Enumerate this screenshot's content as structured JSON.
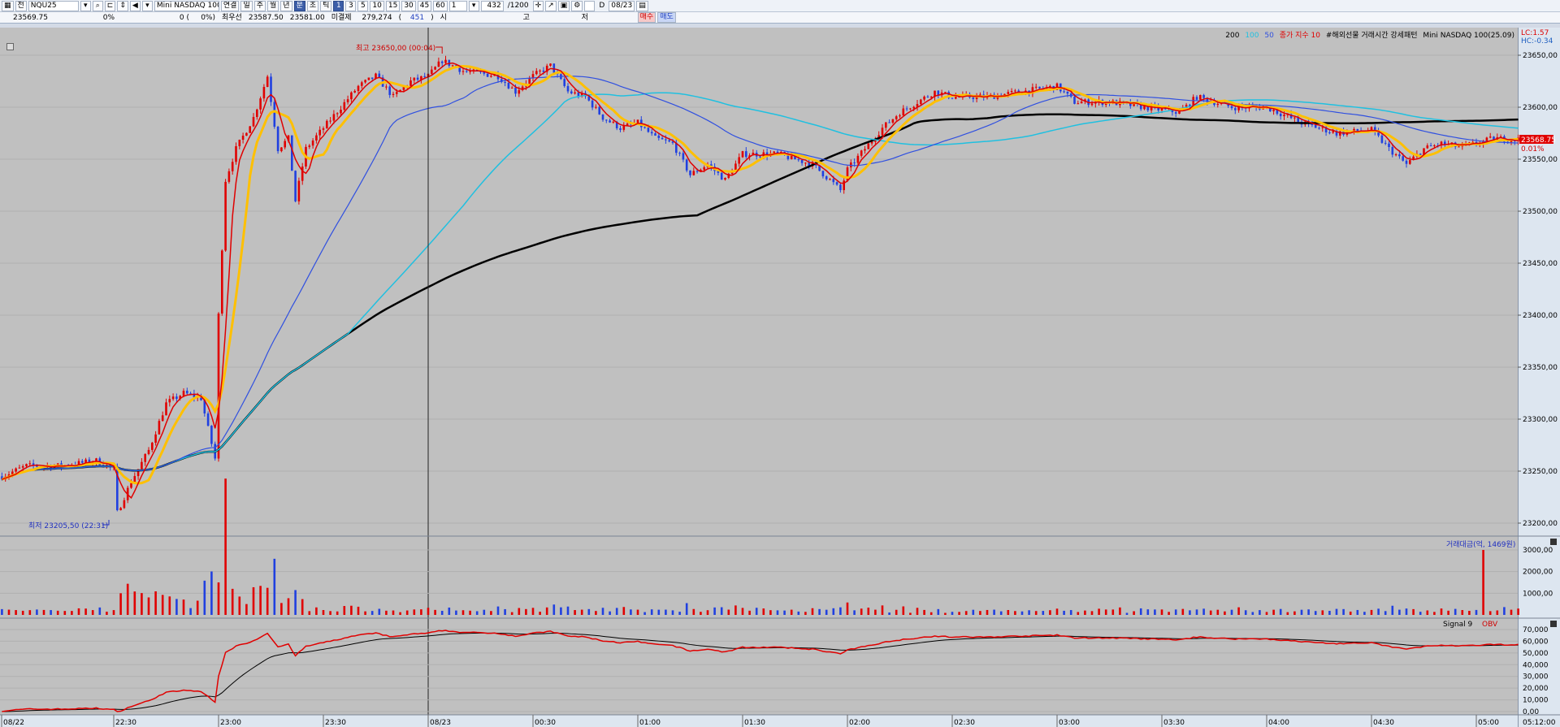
{
  "toolbar": {
    "mode_label": "전",
    "symbol": "NQU25",
    "product_name": "Mini NASDAQ 100(25.0",
    "period_tabs": [
      "연결",
      "일",
      "주",
      "월",
      "년",
      "분",
      "초",
      "틱"
    ],
    "period_selected": "분",
    "intervals": [
      "1",
      "3",
      "5",
      "10",
      "15",
      "30",
      "45",
      "60"
    ],
    "interval_selected": "1",
    "unit_value": "1",
    "count": "432",
    "count_max": "/1200",
    "d_label": "D",
    "date": "08/23"
  },
  "quote": {
    "price": "23569.75",
    "change_pct": "0%",
    "change": "0 (",
    "change_pct2": "0%)",
    "best_label": "최우선",
    "best_bid": "23587.50",
    "best_ask": "23581.00",
    "oi_label": "미결제",
    "oi": "279,274",
    "oi_open": "(",
    "oi_change": "451",
    "oi_close": ")",
    "open_label": "시",
    "high_label": "고",
    "low_label": "저",
    "buy": "매수",
    "sell": "매도"
  },
  "legend": {
    "ma200": "200",
    "ma100": "100",
    "ma50": "50",
    "close_index": "종가 지수 10",
    "pattern": "#해외선물 거래시간 강세패턴",
    "instrument": "Mini NASDAQ 100(25.09)",
    "lc": "LC:1.57",
    "hc": "HC:-0.34"
  },
  "colors": {
    "up": "#e00000",
    "down": "#2040e0",
    "ma200": "#000000",
    "ma100": "#20c0e0",
    "ma50": "#3050e0",
    "ma10": "#ffc000",
    "ma5": "#e00000"
  },
  "chart_data": {
    "type": "candlestick",
    "x_ticks": [
      "08/22",
      "22:30",
      "23:00",
      "23:30",
      "08/23",
      "00:30",
      "01:00",
      "01:30",
      "02:00",
      "02:30",
      "03:00",
      "03:30",
      "04:00",
      "04:30",
      "05:00"
    ],
    "x_end": "05:12:00",
    "price_ticks": [
      "23650,00",
      "23600,00",
      "23550,00",
      "23500,00",
      "23450,00",
      "23400,00",
      "23350,00",
      "23300,00",
      "23250,00",
      "23200,00"
    ],
    "ylim": [
      23200,
      23650
    ],
    "price_path": [
      [
        "21:58",
        23245
      ],
      [
        "22:05",
        23255
      ],
      [
        "22:15",
        23255
      ],
      [
        "22:25",
        23260
      ],
      [
        "22:30",
        23252
      ],
      [
        "22:31",
        23210
      ],
      [
        "22:35",
        23240
      ],
      [
        "22:40",
        23270
      ],
      [
        "22:45",
        23315
      ],
      [
        "22:50",
        23325
      ],
      [
        "22:55",
        23320
      ],
      [
        "22:59",
        23262
      ],
      [
        "23:00",
        23400
      ],
      [
        "23:02",
        23530
      ],
      [
        "23:05",
        23560
      ],
      [
        "23:10",
        23590
      ],
      [
        "23:14",
        23630
      ],
      [
        "23:17",
        23560
      ],
      [
        "23:20",
        23570
      ],
      [
        "23:22",
        23510
      ],
      [
        "23:25",
        23560
      ],
      [
        "23:30",
        23580
      ],
      [
        "23:35",
        23600
      ],
      [
        "23:40",
        23620
      ],
      [
        "23:45",
        23630
      ],
      [
        "23:50",
        23610
      ],
      [
        "23:55",
        23625
      ],
      [
        "00:00",
        23630
      ],
      [
        "00:04",
        23645
      ],
      [
        "00:10",
        23635
      ],
      [
        "00:20",
        23630
      ],
      [
        "00:25",
        23615
      ],
      [
        "00:30",
        23630
      ],
      [
        "00:35",
        23640
      ],
      [
        "00:40",
        23615
      ],
      [
        "00:45",
        23610
      ],
      [
        "00:50",
        23590
      ],
      [
        "00:55",
        23580
      ],
      [
        "01:00",
        23585
      ],
      [
        "01:05",
        23570
      ],
      [
        "01:10",
        23565
      ],
      [
        "01:15",
        23535
      ],
      [
        "01:20",
        23545
      ],
      [
        "01:25",
        23530
      ],
      [
        "01:30",
        23555
      ],
      [
        "01:40",
        23555
      ],
      [
        "01:50",
        23545
      ],
      [
        "01:55",
        23530
      ],
      [
        "01:58",
        23520
      ],
      [
        "02:00",
        23540
      ],
      [
        "02:05",
        23560
      ],
      [
        "02:10",
        23580
      ],
      [
        "02:15",
        23595
      ],
      [
        "02:20",
        23605
      ],
      [
        "02:25",
        23615
      ],
      [
        "02:30",
        23610
      ],
      [
        "02:40",
        23610
      ],
      [
        "02:50",
        23615
      ],
      [
        "03:00",
        23620
      ],
      [
        "03:05",
        23605
      ],
      [
        "03:15",
        23605
      ],
      [
        "03:25",
        23600
      ],
      [
        "03:35",
        23595
      ],
      [
        "03:40",
        23610
      ],
      [
        "03:50",
        23600
      ],
      [
        "04:00",
        23600
      ],
      [
        "04:10",
        23585
      ],
      [
        "04:20",
        23575
      ],
      [
        "04:30",
        23578
      ],
      [
        "04:35",
        23560
      ],
      [
        "04:40",
        23545
      ],
      [
        "04:45",
        23560
      ],
      [
        "04:50",
        23565
      ],
      [
        "04:55",
        23562
      ],
      [
        "05:00",
        23565
      ],
      [
        "05:05",
        23570
      ],
      [
        "05:12",
        23569
      ]
    ],
    "high_note": "최고 23650,00 (00:04)",
    "low_note": "최저 23205,50 (22:31)",
    "last_price": "23568.75",
    "last_pct": "0.01%",
    "volume_title": "거래대금(억, 1469원)",
    "volume_ticks": [
      "3000,00",
      "2000,00",
      "1000,00"
    ],
    "obv_labels": {
      "signal": "Signal 9",
      "obv": "OBV"
    },
    "obv_ticks": [
      "70,000",
      "60,000",
      "50,000",
      "40,000",
      "30,000",
      "20,000",
      "10,000",
      "0,00"
    ]
  }
}
